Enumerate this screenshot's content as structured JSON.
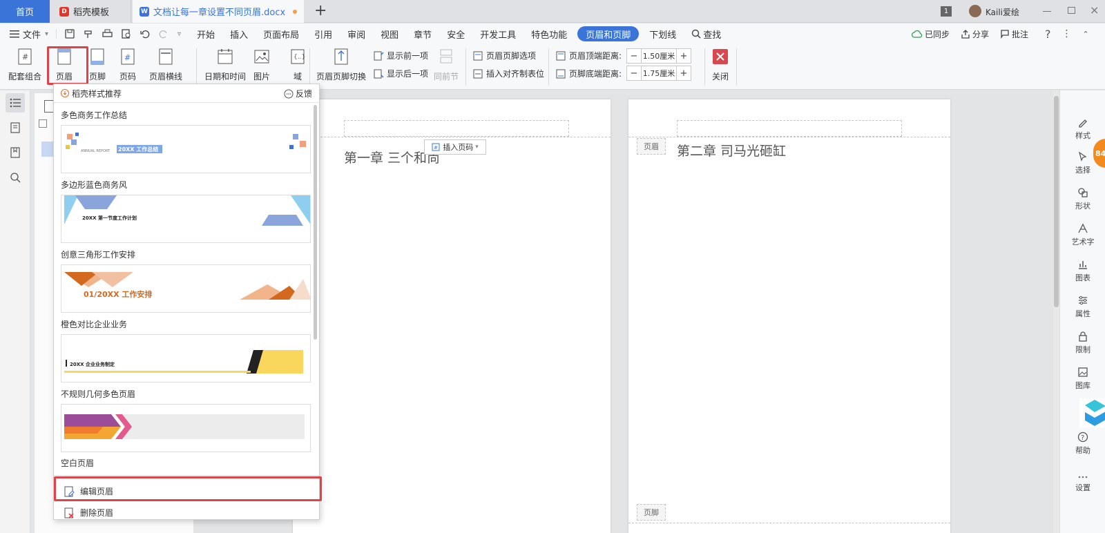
{
  "tabs": {
    "home": "首页",
    "template": "稻壳模板",
    "document": "文档让每一章设置不同页眉.docx",
    "new_tab": "+",
    "window_count": "1",
    "user": "Kaili爱绘"
  },
  "menu": {
    "file": "文件",
    "items": [
      "开始",
      "插入",
      "页面布局",
      "引用",
      "审阅",
      "视图",
      "章节",
      "安全",
      "开发工具",
      "特色功能"
    ],
    "active_tab": "页眉和页脚",
    "after_active": "下划线",
    "search": "查找",
    "synced": "已同步",
    "share": "分享",
    "comment": "批注",
    "help": "?"
  },
  "ribbon": {
    "combo": "配套组合",
    "header": "页眉",
    "footer": "页脚",
    "page_num": "页码",
    "header_line": "页眉横线",
    "date_time": "日期和时间",
    "picture": "图片",
    "field": "域",
    "switch": "页眉页脚切换",
    "show_prev": "显示前一项",
    "show_next": "显示后一项",
    "same_as_prev": "同前节",
    "hf_options": "页眉页脚选项",
    "insert_align_tab": "插入对齐制表位",
    "header_top_label": "页眉顶端距离:",
    "header_top_value": "1.50厘米",
    "footer_bottom_label": "页脚底端距离:",
    "footer_bottom_value": "1.75厘米",
    "close": "关闭"
  },
  "dropdown": {
    "title": "稻壳样式推荐",
    "feedback": "反馈",
    "templates": [
      {
        "name": "多色商务工作总结",
        "thumb_text": "20XX 工作总结",
        "thumb_sub": "ANNUAL REPORT"
      },
      {
        "name": "多边形蓝色商务风",
        "thumb_text": "20XX  第一节度工作计划"
      },
      {
        "name": "创意三角形工作安排",
        "thumb_text": "01/20XX  工作安排"
      },
      {
        "name": "橙色对比企业业务",
        "thumb_text": "20XX  企业业务制定"
      },
      {
        "name": "不规则几何多色页眉"
      },
      {
        "name": "空白页眉"
      }
    ],
    "edit_header": "编辑页眉",
    "delete_header": "删除页眉"
  },
  "document": {
    "page1_chapter": "第一章  三个和尚",
    "page2_chapter": "第二章  司马光砸缸",
    "header_tag": "页眉",
    "footer_tag": "页脚",
    "insert_page_num": "插入页码"
  },
  "right_sidebar": [
    "样式",
    "选择",
    "形状",
    "艺术字",
    "图表",
    "属性",
    "限制",
    "图库",
    "帮助",
    "设置"
  ],
  "badge": "84",
  "colors": {
    "accent": "#3b74d8",
    "highlight": "#e0424a",
    "close_red": "#d9484f"
  }
}
